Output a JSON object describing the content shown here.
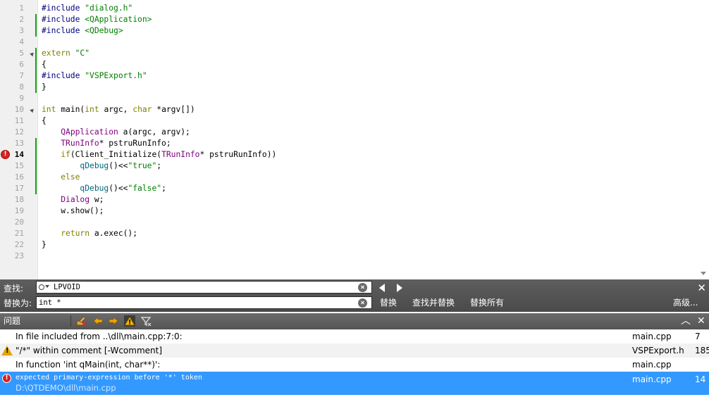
{
  "editor": {
    "lines": [
      {
        "n": "1",
        "tokens": [
          [
            "pp",
            "#include "
          ],
          [
            "str",
            "\"dialog.h\""
          ]
        ]
      },
      {
        "n": "2",
        "tokens": [
          [
            "pp",
            "#include "
          ],
          [
            "str",
            "<QApplication>"
          ]
        ]
      },
      {
        "n": "3",
        "tokens": [
          [
            "pp",
            "#include "
          ],
          [
            "str",
            "<QDebug>"
          ]
        ]
      },
      {
        "n": "4",
        "tokens": []
      },
      {
        "n": "5",
        "tokens": [
          [
            "kw",
            "extern "
          ],
          [
            "str",
            "\"C\""
          ]
        ]
      },
      {
        "n": "6",
        "tokens": [
          [
            "plain",
            "{"
          ]
        ]
      },
      {
        "n": "7",
        "tokens": [
          [
            "pp",
            "#include "
          ],
          [
            "str",
            "\"VSPExport.h\""
          ]
        ]
      },
      {
        "n": "8",
        "tokens": [
          [
            "plain",
            "}"
          ]
        ]
      },
      {
        "n": "9",
        "tokens": []
      },
      {
        "n": "10",
        "tokens": [
          [
            "kw",
            "int "
          ],
          [
            "plain",
            "main("
          ],
          [
            "kw",
            "int "
          ],
          [
            "plain",
            "argc, "
          ],
          [
            "kw",
            "char "
          ],
          [
            "plain",
            "*argv[])"
          ]
        ]
      },
      {
        "n": "11",
        "tokens": [
          [
            "plain",
            "{"
          ]
        ]
      },
      {
        "n": "12",
        "tokens": [
          [
            "plain",
            "    "
          ],
          [
            "ty",
            "QApplication"
          ],
          [
            "plain",
            " a(argc, argv);"
          ]
        ]
      },
      {
        "n": "13",
        "tokens": [
          [
            "plain",
            "    "
          ],
          [
            "ty",
            "TRunInfo"
          ],
          [
            "plain",
            "* pstruRunInfo;"
          ]
        ]
      },
      {
        "n": "14",
        "tokens": [
          [
            "plain",
            "    "
          ],
          [
            "kw",
            "if"
          ],
          [
            "plain",
            "(Client_Initialize("
          ],
          [
            "ty",
            "TRunInfo"
          ],
          [
            "plain",
            "* pstruRunInfo))"
          ]
        ]
      },
      {
        "n": "15",
        "tokens": [
          [
            "plain",
            "        "
          ],
          [
            "fn",
            "qDebug"
          ],
          [
            "plain",
            "()<<"
          ],
          [
            "str",
            "\"true\""
          ],
          [
            "plain",
            ";"
          ]
        ]
      },
      {
        "n": "16",
        "tokens": [
          [
            "plain",
            "    "
          ],
          [
            "kw",
            "else"
          ]
        ]
      },
      {
        "n": "17",
        "tokens": [
          [
            "plain",
            "        "
          ],
          [
            "fn",
            "qDebug"
          ],
          [
            "plain",
            "()<<"
          ],
          [
            "str",
            "\"false\""
          ],
          [
            "plain",
            ";"
          ]
        ]
      },
      {
        "n": "18",
        "tokens": [
          [
            "plain",
            "    "
          ],
          [
            "ty",
            "Dialog"
          ],
          [
            "plain",
            " w;"
          ]
        ]
      },
      {
        "n": "19",
        "tokens": [
          [
            "plain",
            "    w.show();"
          ]
        ]
      },
      {
        "n": "20",
        "tokens": []
      },
      {
        "n": "21",
        "tokens": [
          [
            "plain",
            "    "
          ],
          [
            "kw",
            "return "
          ],
          [
            "plain",
            "a.exec();"
          ]
        ]
      },
      {
        "n": "22",
        "tokens": [
          [
            "plain",
            "}"
          ]
        ]
      },
      {
        "n": "23",
        "tokens": []
      }
    ],
    "current_line": "14",
    "error_line": "14",
    "error_marker": "!",
    "fold_lines": [
      "5",
      "10"
    ],
    "changed_lines": [
      "2",
      "3",
      "5",
      "6",
      "7",
      "8",
      "13",
      "14",
      "15",
      "16",
      "17"
    ]
  },
  "findbar": {
    "find_label": "查找:",
    "find_value": "LPVOID",
    "replace_label": "替换为:",
    "replace_value": "int *",
    "clear_glyph": "×",
    "replace_button": "替换",
    "find_replace_button": "查找并替换",
    "replace_all_button": "替换所有",
    "advanced_button": "高级...",
    "close_glyph": "✕"
  },
  "issues": {
    "title": "问题",
    "rows": [
      {
        "message": "In file included from ..\\dll\\main.cpp:7:0:",
        "file": "main.cpp",
        "line": "7",
        "icon": "none"
      },
      {
        "message": "\"/*\" within comment [-Wcomment]",
        "file": "VSPExport.h",
        "line": "185",
        "icon": "warning"
      },
      {
        "message": "In function 'int qMain(int, char**)':",
        "file": "main.cpp",
        "line": "",
        "icon": "none"
      }
    ],
    "selected": {
      "message": "expected primary-expression before '*' token",
      "path": "D:\\QTDEMO\\dll\\main.cpp",
      "file": "main.cpp",
      "line": "14",
      "icon": "error"
    },
    "collapse_glyph": "︿",
    "close_glyph": "✕"
  },
  "colors": {
    "keyword": "#808000",
    "preprocessor": "#000080",
    "string": "#008000",
    "type": "#800080",
    "function": "#00677c",
    "selection": "#3399ff",
    "change_bar": "#13a10e",
    "error": "#d8231f"
  }
}
